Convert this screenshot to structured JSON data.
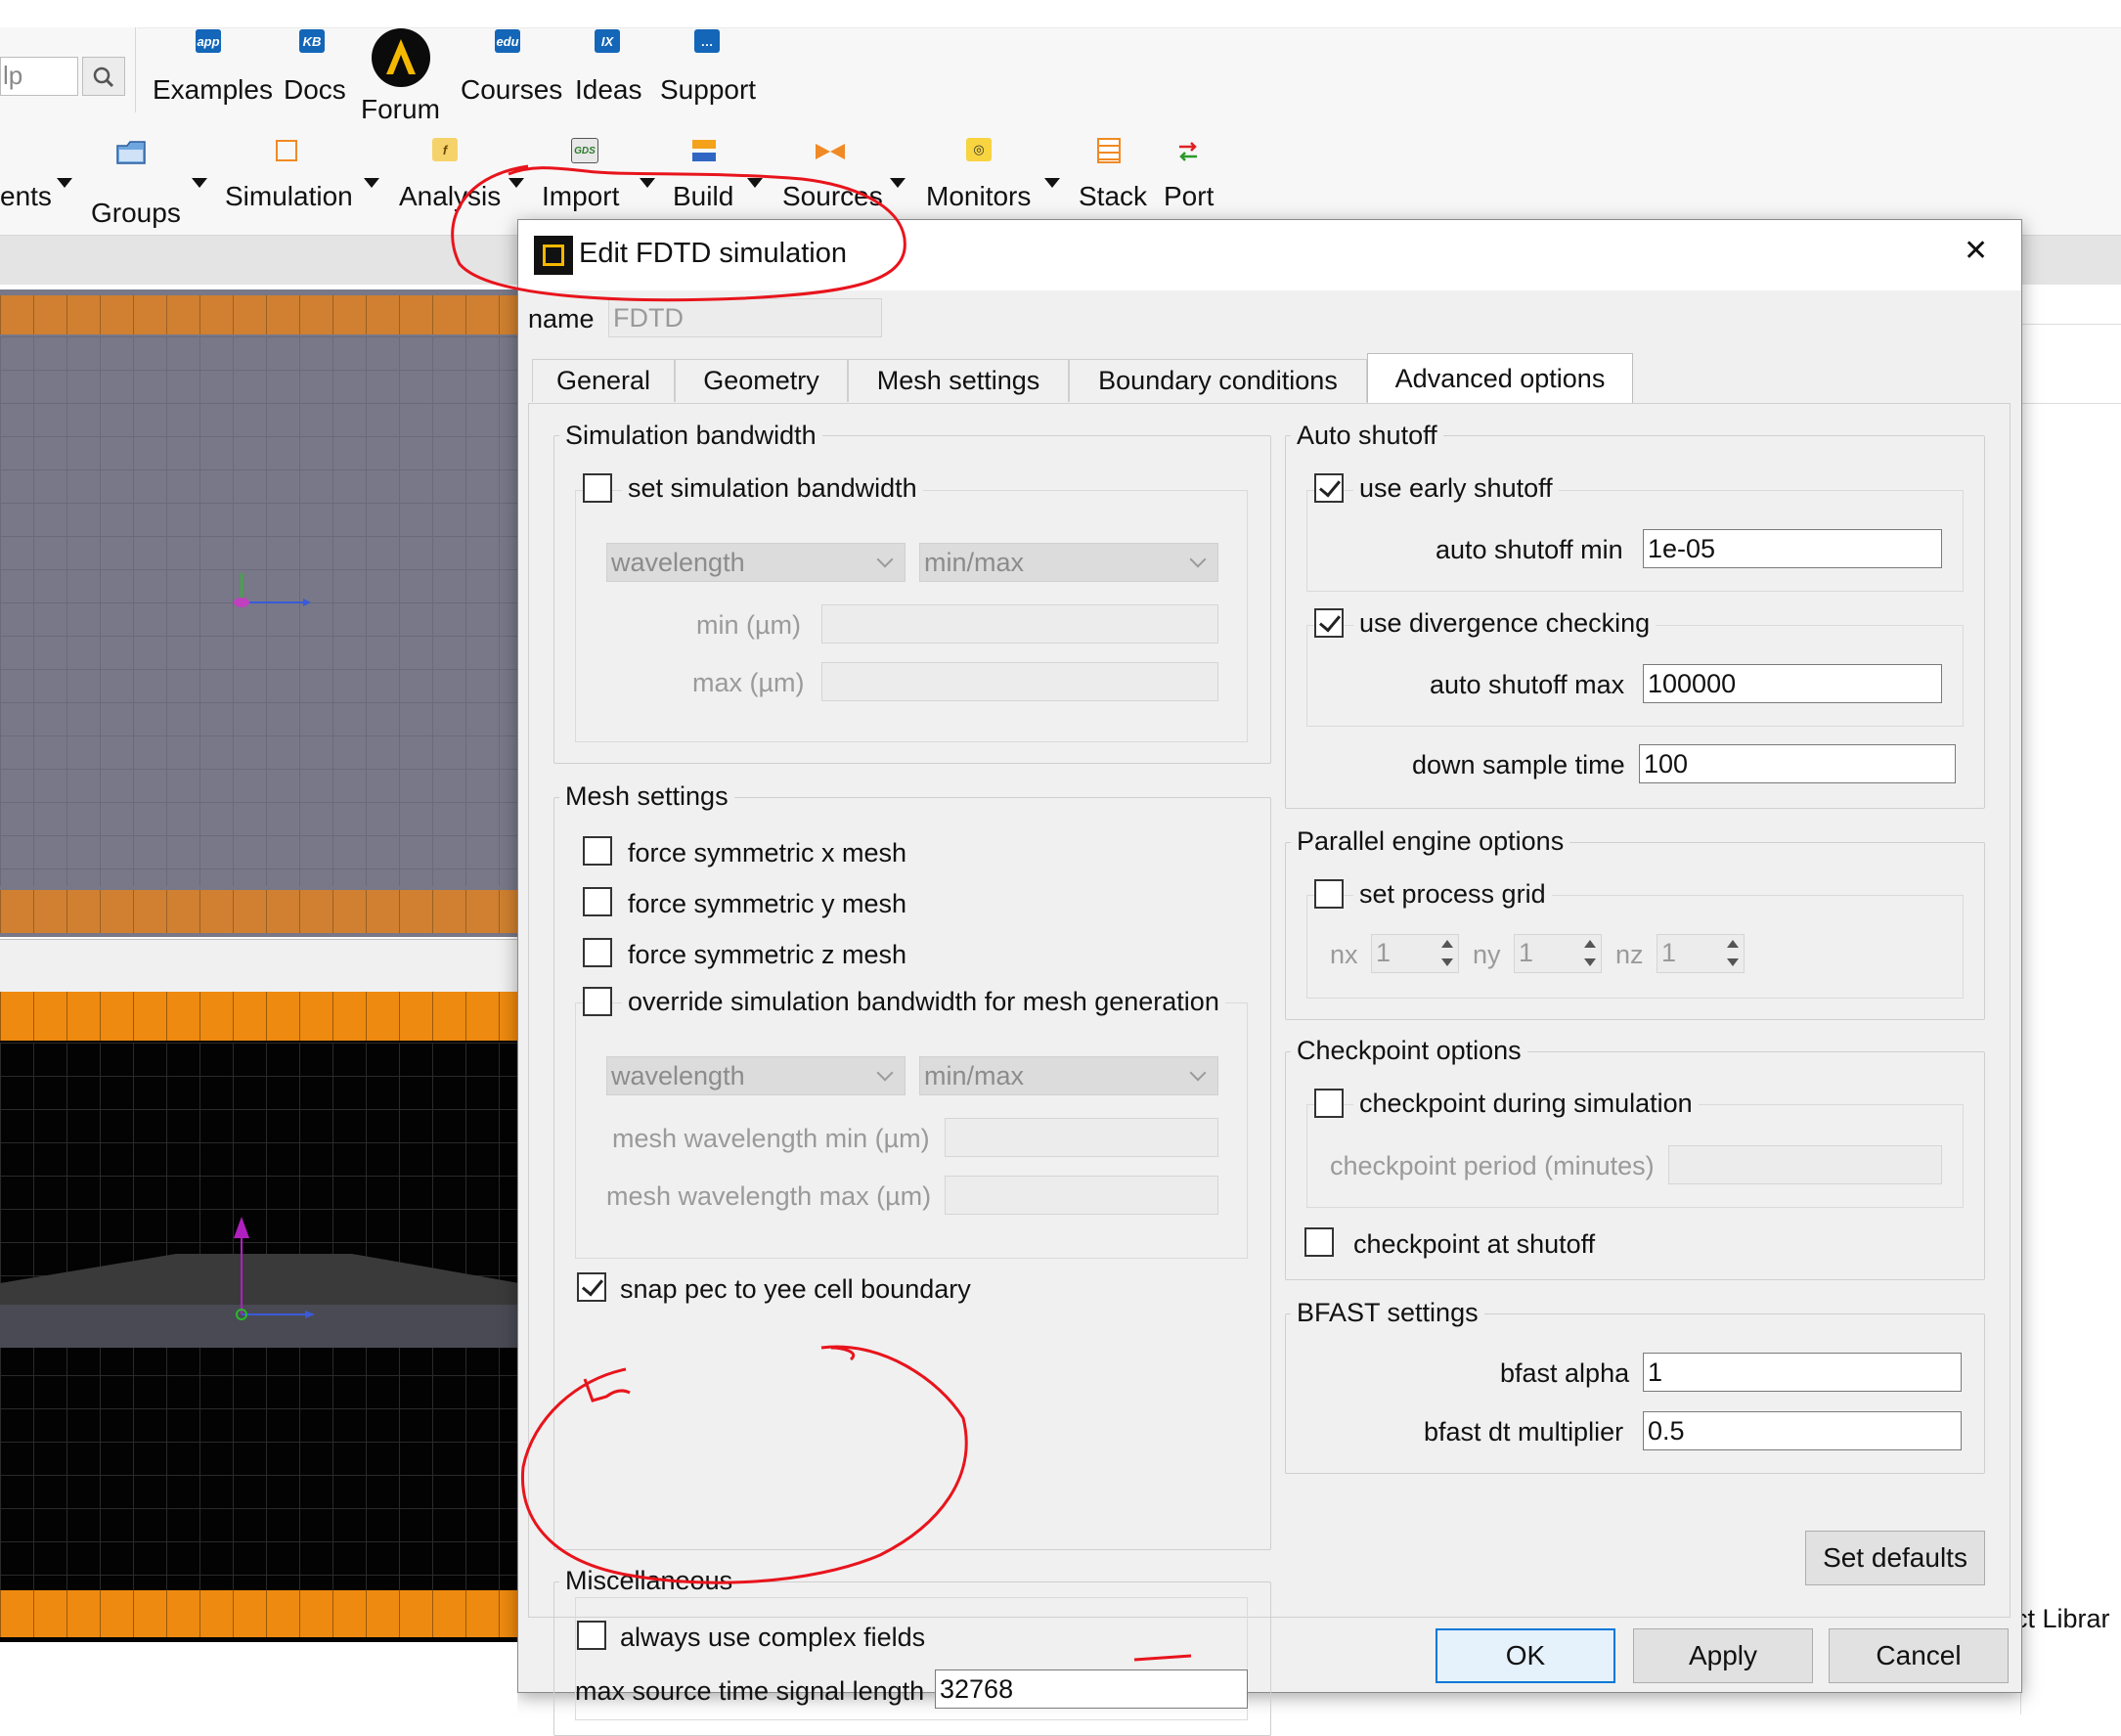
{
  "ribbon": {
    "search_partial": "lp",
    "learn_items": [
      {
        "icon": "app",
        "label": "Examples"
      },
      {
        "icon": "KB",
        "label": "Docs"
      },
      {
        "icon": "forum-logo",
        "label": "Forum"
      },
      {
        "icon": "edu",
        "label": "Courses"
      },
      {
        "icon": "IX",
        "label": "Ideas"
      },
      {
        "icon": "chat",
        "label": "Support"
      }
    ],
    "tools": {
      "components_partial": "ents",
      "groups": "Groups",
      "simulation": "Simulation",
      "analysis": "Analysis",
      "import": "Import",
      "build": "Build",
      "sources": "Sources",
      "monitors": "Monitors",
      "stack": "Stack",
      "port": "Port"
    },
    "right_partial": "ct Librar"
  },
  "dialog": {
    "title": "Edit FDTD simulation",
    "close": "✕",
    "name_label": "name",
    "name_value": "FDTD",
    "tabs": [
      "General",
      "Geometry",
      "Mesh settings",
      "Boundary conditions",
      "Advanced options"
    ],
    "active_tab": "Advanced options",
    "sim_bandwidth": {
      "title": "Simulation bandwidth",
      "set_label": "set simulation bandwidth",
      "set_checked": false,
      "combo1": "wavelength",
      "combo2": "min/max",
      "min_label": "min (µm)",
      "max_label": "max (µm)"
    },
    "mesh_settings": {
      "title": "Mesh settings",
      "sym_x": "force symmetric x mesh",
      "sym_y": "force symmetric y mesh",
      "sym_z": "force symmetric z mesh",
      "override": "override simulation bandwidth for mesh generation",
      "combo1": "wavelength",
      "combo2": "min/max",
      "wl_min_label": "mesh wavelength min (µm)",
      "wl_max_label": "mesh wavelength max (µm)",
      "snap_label": "snap pec to yee cell boundary",
      "snap_checked": true
    },
    "misc": {
      "title": "Miscellaneous",
      "complex_label": "always use complex fields",
      "complex_checked": false,
      "max_source_label": "max source time signal length",
      "max_source_value": "32768"
    },
    "auto_shutoff": {
      "title": "Auto shutoff",
      "early_label": "use early shutoff",
      "early_checked": true,
      "min_label": "auto shutoff min",
      "min_value": "1e-05",
      "divergence_label": "use divergence checking",
      "divergence_checked": true,
      "max_label": "auto shutoff max",
      "max_value": "100000",
      "downsample_label": "down sample time",
      "downsample_value": "100"
    },
    "parallel": {
      "title": "Parallel engine options",
      "grid_label": "set process grid",
      "grid_checked": false,
      "nx_label": "nx",
      "nx_value": "1",
      "ny_label": "ny",
      "ny_value": "1",
      "nz_label": "nz",
      "nz_value": "1"
    },
    "checkpoint": {
      "title": "Checkpoint options",
      "during_label": "checkpoint during simulation",
      "during_checked": false,
      "period_label": "checkpoint period (minutes)",
      "shutoff_label": "checkpoint at shutoff",
      "shutoff_checked": false
    },
    "bfast": {
      "title": "BFAST settings",
      "alpha_label": "bfast alpha",
      "alpha_value": "1",
      "dt_label": "bfast dt multiplier",
      "dt_value": "0.5"
    },
    "buttons": {
      "set_defaults": "Set defaults",
      "ok": "OK",
      "apply": "Apply",
      "cancel": "Cancel"
    }
  },
  "colors": {
    "annotation_red": "#e8141c",
    "accent_blue": "#0078d7",
    "orange_stripe": "#ee8a10",
    "grid_gray": "#787888"
  }
}
